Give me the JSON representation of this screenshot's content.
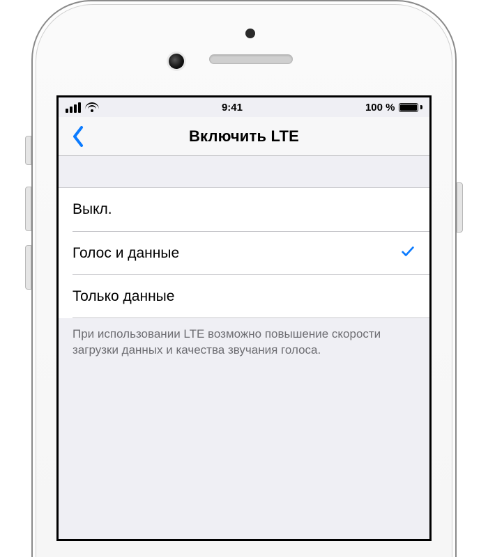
{
  "status": {
    "time": "9:41",
    "battery_text": "100 %"
  },
  "nav": {
    "title": "Включить LTE"
  },
  "options": {
    "off": "Выкл.",
    "voice_data": "Голос и данные",
    "data_only": "Только данные",
    "selected_index": 1
  },
  "footer": {
    "note": "При использовании LTE возможно повышение скорости загрузки данных и качества звучания голоса."
  },
  "colors": {
    "accent": "#0b7bff"
  }
}
